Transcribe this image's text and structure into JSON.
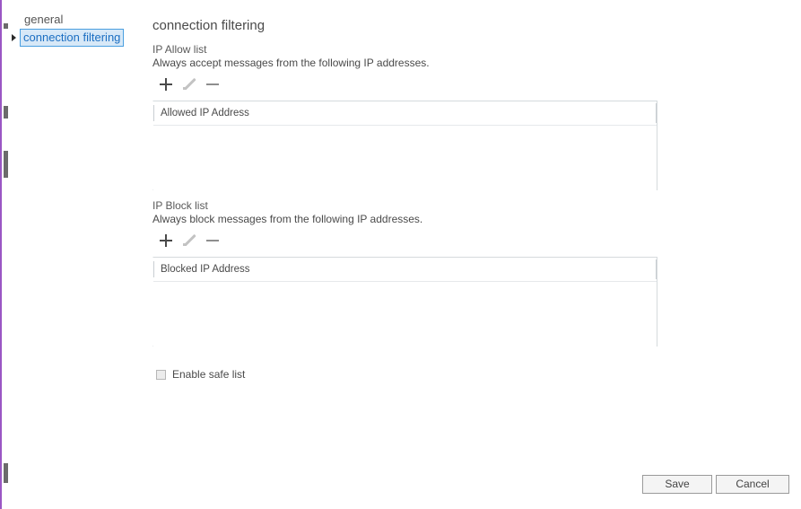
{
  "app": {
    "accent_border_color": "#9a57c4",
    "selection_color": "#1b6ec2",
    "selection_bg": "#d7e8f7"
  },
  "sidebar": {
    "items": [
      {
        "label": "general",
        "selected": false,
        "has_arrow": false
      },
      {
        "label": "connection filtering",
        "selected": true,
        "has_arrow": true
      }
    ]
  },
  "main": {
    "title": "connection filtering",
    "sections": [
      {
        "label": "IP Allow list",
        "description": "Always accept messages from the following IP addresses.",
        "toolbar": [
          {
            "name": "add-icon",
            "glyph": "+",
            "enabled": true
          },
          {
            "name": "edit-icon",
            "glyph": "pencil",
            "enabled": false
          },
          {
            "name": "remove-icon",
            "glyph": "-",
            "enabled": true
          }
        ],
        "list": {
          "column_header": "Allowed IP Address",
          "rows": []
        }
      },
      {
        "label": "IP Block list",
        "description": "Always block messages from the following IP addresses.",
        "toolbar": [
          {
            "name": "add-icon",
            "glyph": "+",
            "enabled": true
          },
          {
            "name": "edit-icon",
            "glyph": "pencil",
            "enabled": false
          },
          {
            "name": "remove-icon",
            "glyph": "-",
            "enabled": true
          }
        ],
        "list": {
          "column_header": "Blocked IP Address",
          "rows": []
        }
      }
    ],
    "safe_list": {
      "label": "Enable safe list",
      "checked": false
    }
  },
  "footer": {
    "save_label": "Save",
    "cancel_label": "Cancel"
  }
}
